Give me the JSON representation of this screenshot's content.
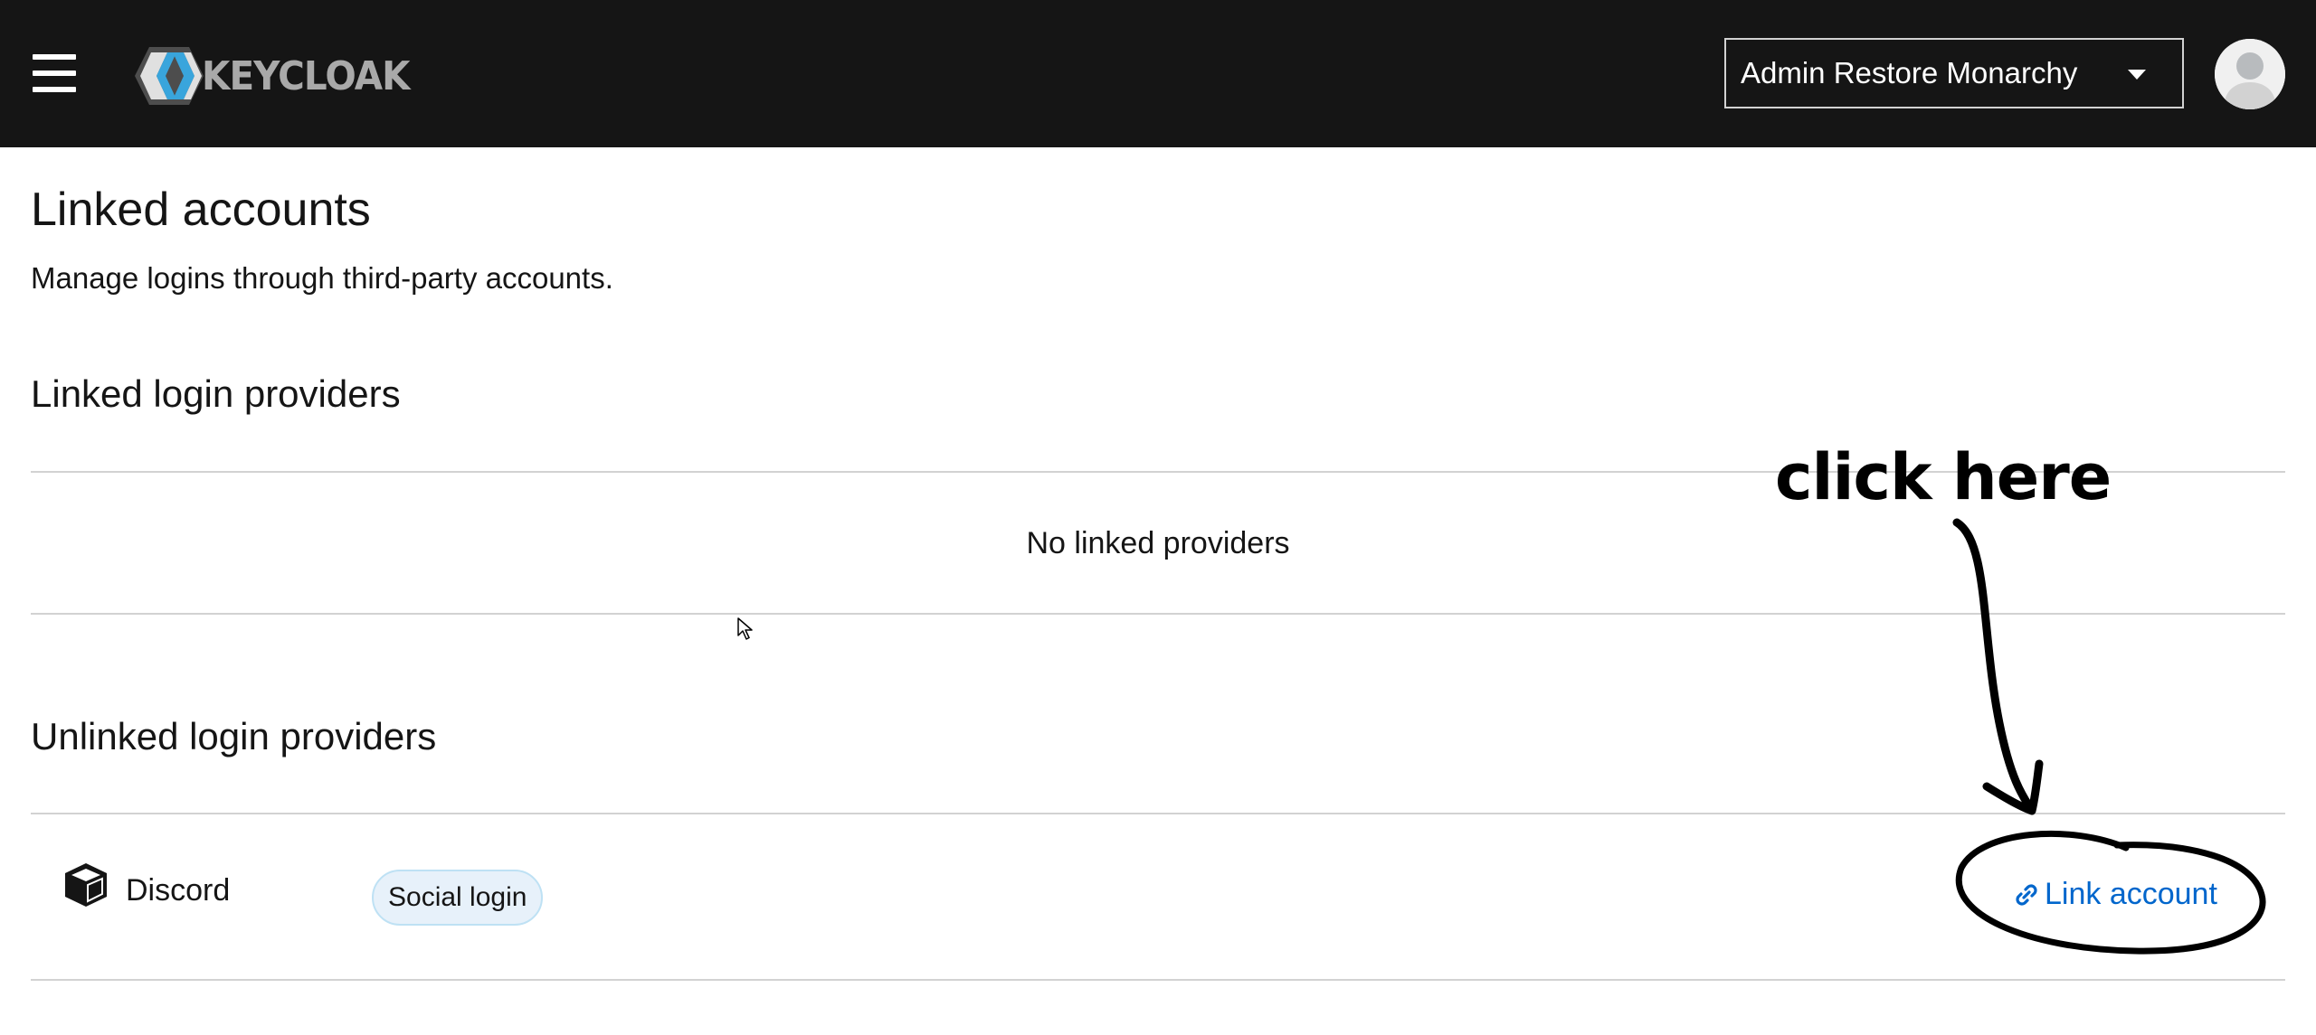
{
  "header": {
    "menu_icon": "hamburger-icon",
    "brand_text": "KEYCLOAK",
    "user_select_label": "Admin Restore Monarchy",
    "avatar_icon": "user-avatar-icon",
    "colors": {
      "background": "#151515",
      "logo_blue": "#39a5dc",
      "logo_gray": "#a9a9a9"
    }
  },
  "page": {
    "title": "Linked accounts",
    "description": "Manage logins through third-party accounts."
  },
  "linked_section": {
    "title": "Linked login providers",
    "empty_text": "No linked providers"
  },
  "unlinked_section": {
    "title": "Unlinked login providers",
    "providers": [
      {
        "name": "Discord",
        "icon": "cube-icon",
        "badge": "Social login",
        "action_label": "Link account",
        "action_icon": "link-icon"
      }
    ]
  },
  "annotation": {
    "text": "click here"
  }
}
